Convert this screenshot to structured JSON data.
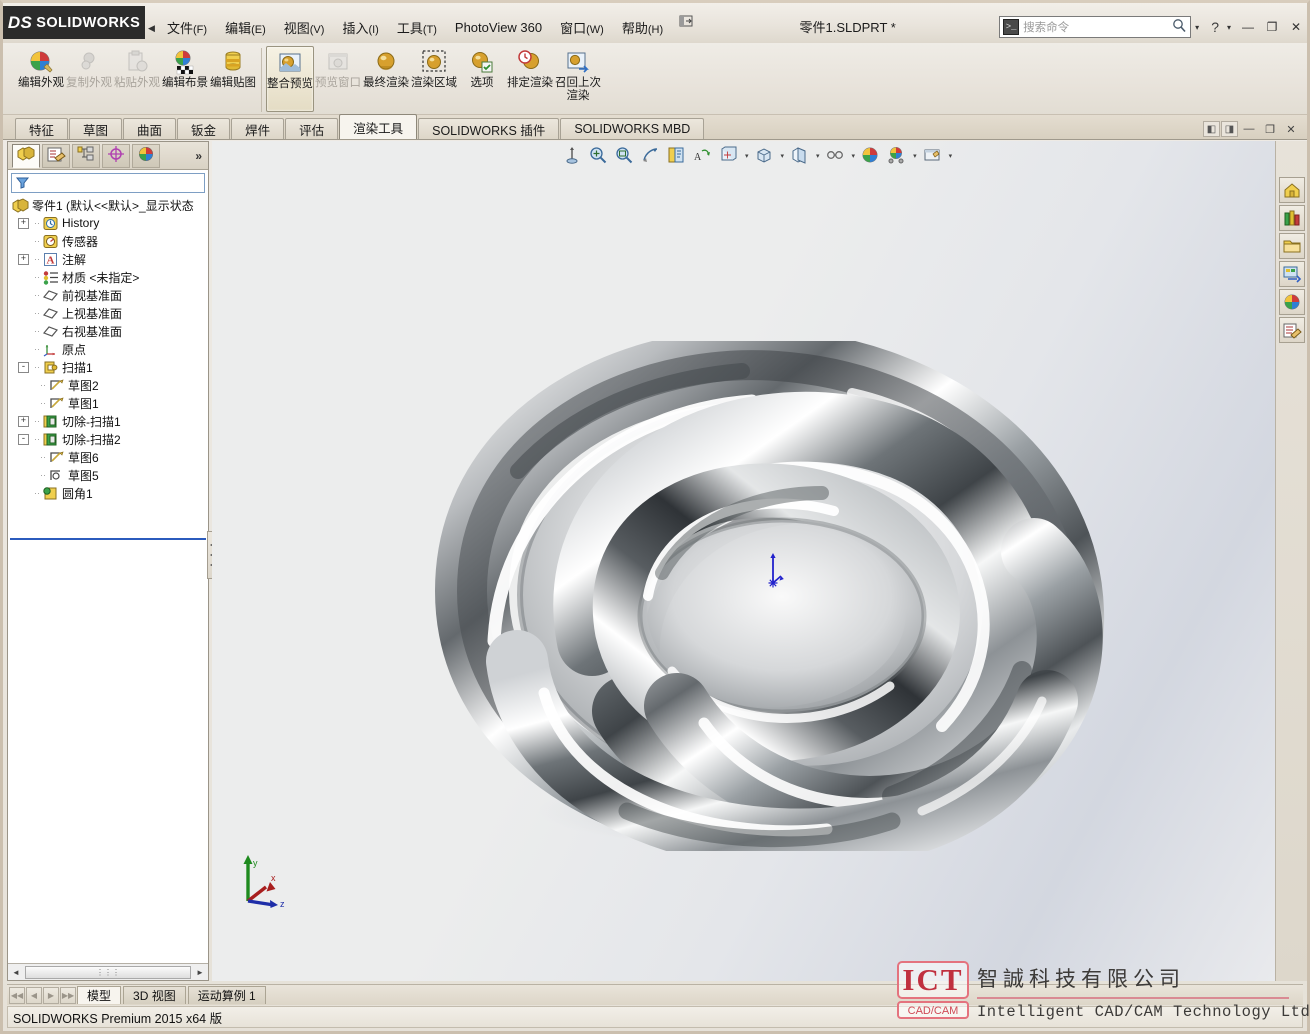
{
  "app": {
    "brand": "SOLIDWORKS",
    "brand_prefix": "DS",
    "document_title": "零件1.SLDPRT *",
    "status_text": "SOLIDWORKS Premium 2015 x64 版"
  },
  "menu": {
    "items": [
      {
        "label": "文件",
        "mnemonic": "(F)"
      },
      {
        "label": "编辑",
        "mnemonic": "(E)"
      },
      {
        "label": "视图",
        "mnemonic": "(V)"
      },
      {
        "label": "插入",
        "mnemonic": "(I)"
      },
      {
        "label": "工具",
        "mnemonic": "(T)"
      },
      {
        "label": "PhotoView 360",
        "mnemonic": ""
      },
      {
        "label": "窗口",
        "mnemonic": "(W)"
      },
      {
        "label": "帮助",
        "mnemonic": "(H)"
      }
    ],
    "collapse_arrow": "◀",
    "pin_icon": "pin-icon"
  },
  "search": {
    "placeholder": "搜索命令",
    "icon": "command-search-icon",
    "magnifier": "search-icon",
    "dropdown": "▾"
  },
  "window_controls": {
    "help": "?",
    "help_dropdown": "▾",
    "minimize": "—",
    "restore": "❐",
    "close": "✕"
  },
  "ribbon": {
    "buttons": [
      {
        "label": "编辑外观",
        "icon": "edit-appearance-icon",
        "state": "normal"
      },
      {
        "label": "复制外观",
        "icon": "copy-appearance-icon",
        "state": "disabled"
      },
      {
        "label": "粘贴外观",
        "icon": "paste-appearance-icon",
        "state": "disabled"
      },
      {
        "label": "编辑布景",
        "icon": "edit-scene-icon",
        "state": "normal"
      },
      {
        "label": "编辑贴图",
        "icon": "edit-decal-icon",
        "state": "normal"
      },
      {
        "label": "整合预览",
        "icon": "integrated-preview-icon",
        "state": "active"
      },
      {
        "label": "预览窗口",
        "icon": "preview-window-icon",
        "state": "disabled"
      },
      {
        "label": "最终渲染",
        "icon": "final-render-icon",
        "state": "normal"
      },
      {
        "label": "渲染区域",
        "icon": "render-region-icon",
        "state": "normal"
      },
      {
        "label": "选项",
        "icon": "options-icon",
        "state": "normal"
      },
      {
        "label": "排定渲染",
        "icon": "schedule-render-icon",
        "state": "normal"
      },
      {
        "label": "召回上次渲染",
        "icon": "recall-last-render-icon",
        "state": "normal"
      }
    ]
  },
  "command_tabs": {
    "items": [
      {
        "label": "特征",
        "selected": false
      },
      {
        "label": "草图",
        "selected": false
      },
      {
        "label": "曲面",
        "selected": false
      },
      {
        "label": "钣金",
        "selected": false
      },
      {
        "label": "焊件",
        "selected": false
      },
      {
        "label": "评估",
        "selected": false
      },
      {
        "label": "渲染工具",
        "selected": true
      },
      {
        "label": "SOLIDWORKS 插件",
        "selected": false
      },
      {
        "label": "SOLIDWORKS MBD",
        "selected": false
      }
    ],
    "view_controls": [
      {
        "icon": "tile-left-icon",
        "glyph": "◧"
      },
      {
        "icon": "tile-right-icon",
        "glyph": "◨"
      },
      {
        "icon": "minimize-doc-icon",
        "glyph": "—"
      },
      {
        "icon": "restore-doc-icon",
        "glyph": "❐"
      },
      {
        "icon": "close-doc-icon",
        "glyph": "✕"
      }
    ]
  },
  "tree_panel": {
    "tabs": [
      {
        "icon": "feature-manager-icon",
        "selected": true
      },
      {
        "icon": "property-manager-icon",
        "selected": false
      },
      {
        "icon": "configuration-manager-icon",
        "selected": false
      },
      {
        "icon": "dimxpert-manager-icon",
        "selected": false
      },
      {
        "icon": "display-manager-icon",
        "selected": false
      }
    ],
    "chevron": "»",
    "filter_icon": "filter-icon",
    "nodes": [
      {
        "label": "零件1  (默认<<默认>_显示状态",
        "icon": "part-icon",
        "indent": 0,
        "toggle": "none"
      },
      {
        "label": "History",
        "icon": "history-icon",
        "indent": 1,
        "toggle": "+"
      },
      {
        "label": "传感器",
        "icon": "sensors-icon",
        "indent": 1,
        "toggle": "none"
      },
      {
        "label": "注解",
        "icon": "annotations-icon",
        "indent": 1,
        "toggle": "+"
      },
      {
        "label": "材质 <未指定>",
        "icon": "material-icon",
        "indent": 1,
        "toggle": "none"
      },
      {
        "label": "前视基准面",
        "icon": "plane-icon",
        "indent": 1,
        "toggle": "none"
      },
      {
        "label": "上视基准面",
        "icon": "plane-icon",
        "indent": 1,
        "toggle": "none"
      },
      {
        "label": "右视基准面",
        "icon": "plane-icon",
        "indent": 1,
        "toggle": "none"
      },
      {
        "label": "原点",
        "icon": "origin-icon",
        "indent": 1,
        "toggle": "none"
      },
      {
        "label": "扫描1",
        "icon": "sweep-icon",
        "indent": 1,
        "toggle": "-"
      },
      {
        "label": "草图2",
        "icon": "sketch-icon",
        "indent": 2,
        "toggle": "none"
      },
      {
        "label": "草图1",
        "icon": "sketch-icon",
        "indent": 2,
        "toggle": "none"
      },
      {
        "label": "切除-扫描1",
        "icon": "cut-sweep-icon",
        "indent": 1,
        "toggle": "+"
      },
      {
        "label": "切除-扫描2",
        "icon": "cut-sweep-icon",
        "indent": 1,
        "toggle": "-"
      },
      {
        "label": "草图6",
        "icon": "sketch-icon",
        "indent": 2,
        "toggle": "none"
      },
      {
        "label": "草图5",
        "icon": "sketch-circle-icon",
        "indent": 2,
        "toggle": "none"
      },
      {
        "label": "圆角1",
        "icon": "fillet-icon",
        "indent": 1,
        "toggle": "none"
      }
    ],
    "hscroll": {
      "left_arrow": "◄",
      "right_arrow": "►",
      "grip": "⋮⋮⋮"
    }
  },
  "viewport": {
    "toolbar": [
      {
        "icon": "section-view-icon",
        "dropdown": false
      },
      {
        "icon": "zoom-to-fit-icon",
        "dropdown": false
      },
      {
        "icon": "zoom-to-area-icon",
        "dropdown": false
      },
      {
        "icon": "rotate-view-icon",
        "dropdown": false
      },
      {
        "icon": "view-orientation-icon",
        "dropdown": false
      },
      {
        "icon": "previous-view-icon",
        "dropdown": false
      },
      {
        "icon": "display-style-icon",
        "dropdown": true
      },
      {
        "icon": "hide-show-items-icon",
        "dropdown": true
      },
      {
        "icon": "scene-icon",
        "dropdown": true
      },
      {
        "icon": "view-settings-icon",
        "dropdown": true
      },
      {
        "icon": "appearances-icon",
        "dropdown": false
      },
      {
        "icon": "apply-scene-icon",
        "dropdown": true
      },
      {
        "icon": "viewport-layout-icon",
        "dropdown": true
      }
    ],
    "triad": {
      "x_label": "x",
      "y_label": "y",
      "z_label": "z"
    },
    "origin_marker": "origin-marker-icon"
  },
  "right_dock": {
    "buttons": [
      {
        "icon": "solidworks-resources-icon"
      },
      {
        "icon": "design-library-icon"
      },
      {
        "icon": "file-explorer-icon"
      },
      {
        "icon": "view-palette-icon"
      },
      {
        "icon": "appearances-scenes-icon"
      },
      {
        "icon": "custom-properties-icon"
      }
    ]
  },
  "bottom": {
    "nav_buttons": [
      "◀◀",
      "◀",
      "▶",
      "▶▶"
    ],
    "tabs": [
      {
        "label": "模型",
        "selected": true
      },
      {
        "label": "3D 视图",
        "selected": false
      },
      {
        "label": "运动算例 1",
        "selected": false
      }
    ]
  },
  "watermark": {
    "logo_top": "ICT",
    "logo_bottom": "CAD/CAM",
    "chinese": "智誠科技有限公司",
    "english": "Intelligent CAD/CAM Technology Ltd."
  },
  "colors": {
    "accent_blue": "#2b5bbd",
    "chrome_bg": "#e8e3db",
    "tab_selected_bg": "#f7f4ee",
    "watermark_red": "#c0303f",
    "viewport_bg": "#eceded"
  }
}
